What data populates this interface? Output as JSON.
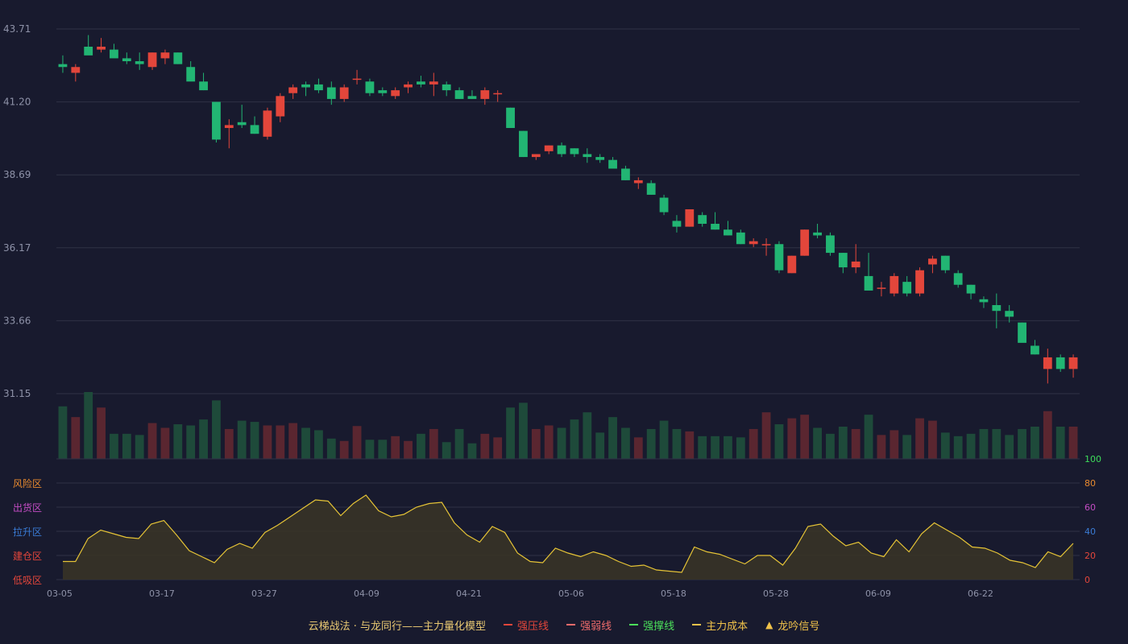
{
  "chart_data": {
    "type": "candlestick",
    "y_ticks": [
      "43.71",
      "41.20",
      "38.69",
      "36.17",
      "33.66",
      "31.15"
    ],
    "ylim": [
      31.15,
      43.71
    ],
    "x_tick_labels": [
      {
        "index": 0,
        "label": "03-05"
      },
      {
        "index": 8,
        "label": "03-17"
      },
      {
        "index": 16,
        "label": "03-27"
      },
      {
        "index": 24,
        "label": "04-09"
      },
      {
        "index": 32,
        "label": "04-21"
      },
      {
        "index": 40,
        "label": "05-06"
      },
      {
        "index": 48,
        "label": "05-18"
      },
      {
        "index": 56,
        "label": "05-28"
      },
      {
        "index": 64,
        "label": "06-09"
      },
      {
        "index": 72,
        "label": "06-22"
      }
    ],
    "ohlc": [
      [
        42.5,
        42.8,
        42.2,
        42.4
      ],
      [
        42.2,
        42.5,
        41.9,
        42.4
      ],
      [
        43.1,
        43.5,
        42.9,
        42.8
      ],
      [
        43.0,
        43.4,
        42.9,
        43.1
      ],
      [
        43.0,
        43.2,
        42.9,
        42.7
      ],
      [
        42.7,
        42.9,
        42.5,
        42.6
      ],
      [
        42.6,
        42.9,
        42.3,
        42.5
      ],
      [
        42.4,
        42.9,
        42.3,
        42.9
      ],
      [
        42.7,
        43.0,
        42.5,
        42.9
      ],
      [
        42.9,
        42.9,
        42.5,
        42.5
      ],
      [
        42.4,
        42.6,
        42.0,
        41.9
      ],
      [
        41.9,
        42.2,
        41.6,
        41.6
      ],
      [
        41.2,
        41.2,
        39.8,
        39.9
      ],
      [
        40.3,
        40.6,
        39.6,
        40.4
      ],
      [
        40.5,
        41.1,
        40.3,
        40.4
      ],
      [
        40.4,
        40.7,
        40.1,
        40.1
      ],
      [
        40.0,
        41.0,
        39.9,
        40.9
      ],
      [
        40.7,
        41.5,
        40.5,
        41.4
      ],
      [
        41.5,
        41.8,
        41.3,
        41.7
      ],
      [
        41.8,
        41.9,
        41.4,
        41.7
      ],
      [
        41.8,
        42.0,
        41.5,
        41.6
      ],
      [
        41.7,
        41.9,
        41.1,
        41.3
      ],
      [
        41.3,
        41.8,
        41.2,
        41.7
      ],
      [
        42.0,
        42.3,
        41.8,
        42.0
      ],
      [
        41.9,
        42.0,
        41.4,
        41.5
      ],
      [
        41.6,
        41.7,
        41.4,
        41.5
      ],
      [
        41.4,
        41.7,
        41.3,
        41.6
      ],
      [
        41.7,
        41.9,
        41.5,
        41.8
      ],
      [
        41.9,
        42.1,
        41.7,
        41.8
      ],
      [
        41.8,
        42.2,
        41.4,
        41.9
      ],
      [
        41.8,
        41.9,
        41.4,
        41.6
      ],
      [
        41.6,
        41.7,
        41.3,
        41.3
      ],
      [
        41.4,
        41.6,
        41.3,
        41.3
      ],
      [
        41.3,
        41.7,
        41.1,
        41.6
      ],
      [
        41.5,
        41.6,
        41.2,
        41.5
      ],
      [
        41.0,
        41.0,
        40.3,
        40.3
      ],
      [
        40.2,
        40.2,
        39.3,
        39.3
      ],
      [
        39.3,
        39.4,
        39.2,
        39.4
      ],
      [
        39.5,
        39.7,
        39.4,
        39.7
      ],
      [
        39.7,
        39.8,
        39.3,
        39.4
      ],
      [
        39.6,
        39.6,
        39.3,
        39.4
      ],
      [
        39.4,
        39.6,
        39.1,
        39.3
      ],
      [
        39.3,
        39.4,
        39.1,
        39.2
      ],
      [
        39.2,
        39.3,
        38.9,
        38.9
      ],
      [
        38.9,
        39.0,
        38.5,
        38.5
      ],
      [
        38.4,
        38.6,
        38.2,
        38.5
      ],
      [
        38.4,
        38.5,
        38.0,
        38.0
      ],
      [
        37.9,
        38.0,
        37.3,
        37.4
      ],
      [
        37.1,
        37.3,
        36.7,
        36.9
      ],
      [
        36.9,
        37.5,
        36.9,
        37.5
      ],
      [
        37.3,
        37.4,
        36.9,
        37.0
      ],
      [
        37.0,
        37.4,
        36.8,
        36.8
      ],
      [
        36.8,
        37.1,
        36.6,
        36.6
      ],
      [
        36.7,
        36.8,
        36.3,
        36.3
      ],
      [
        36.3,
        36.5,
        36.2,
        36.4
      ],
      [
        36.3,
        36.5,
        35.9,
        36.3
      ],
      [
        36.3,
        36.4,
        35.3,
        35.4
      ],
      [
        35.3,
        35.9,
        35.3,
        35.9
      ],
      [
        35.9,
        36.8,
        35.9,
        36.8
      ],
      [
        36.7,
        37.0,
        36.5,
        36.6
      ],
      [
        36.6,
        36.7,
        35.9,
        36.0
      ],
      [
        36.0,
        36.0,
        35.3,
        35.5
      ],
      [
        35.5,
        36.3,
        35.3,
        35.7
      ],
      [
        35.2,
        36.0,
        35.1,
        34.7
      ],
      [
        34.8,
        35.0,
        34.5,
        34.8
      ],
      [
        34.6,
        35.3,
        34.5,
        35.2
      ],
      [
        35.0,
        35.2,
        34.5,
        34.6
      ],
      [
        34.6,
        35.5,
        34.5,
        35.4
      ],
      [
        35.6,
        35.9,
        35.3,
        35.8
      ],
      [
        35.9,
        35.9,
        35.3,
        35.4
      ],
      [
        35.3,
        35.4,
        34.8,
        34.9
      ],
      [
        34.9,
        34.9,
        34.4,
        34.6
      ],
      [
        34.4,
        34.5,
        34.1,
        34.3
      ],
      [
        34.2,
        34.6,
        33.4,
        34.0
      ],
      [
        34.0,
        34.2,
        33.6,
        33.8
      ],
      [
        33.6,
        33.6,
        33.3,
        32.9
      ],
      [
        32.8,
        33.0,
        32.5,
        32.5
      ],
      [
        32.0,
        32.7,
        31.5,
        32.4
      ],
      [
        32.4,
        32.5,
        31.9,
        32.0
      ],
      [
        32.0,
        32.5,
        31.7,
        32.4
      ]
    ],
    "volumes": [
      88,
      70,
      112,
      86,
      42,
      42,
      40,
      60,
      52,
      58,
      56,
      66,
      98,
      50,
      64,
      62,
      56,
      56,
      60,
      52,
      48,
      34,
      30,
      55,
      32,
      32,
      38,
      30,
      42,
      50,
      28,
      50,
      26,
      42,
      36,
      86,
      94,
      50,
      56,
      52,
      66,
      78,
      44,
      70,
      52,
      36,
      50,
      64,
      50,
      46,
      38,
      38,
      38,
      36,
      50,
      78,
      58,
      68,
      74,
      52,
      42,
      54,
      50,
      74,
      40,
      48,
      40,
      68,
      64,
      44,
      38,
      42,
      50,
      50,
      40,
      50,
      54,
      80,
      54,
      54
    ],
    "volume_colors": "same as candle direction",
    "indicator": {
      "name": "主力量化模型",
      "ylim": [
        0,
        100
      ],
      "right_ticks": [
        {
          "v": 100,
          "label": "100",
          "color": "#3ddc5a"
        },
        {
          "v": 80,
          "label": "80",
          "color": "#e88a2e"
        },
        {
          "v": 60,
          "label": "60",
          "color": "#c44cc4"
        },
        {
          "v": 40,
          "label": "40",
          "color": "#3a7bd5"
        },
        {
          "v": 20,
          "label": "20",
          "color": "#e3463b"
        },
        {
          "v": 0,
          "label": "0",
          "color": "#e3463b"
        }
      ],
      "zones": [
        {
          "label": "风险区",
          "color": "#e88a2e"
        },
        {
          "label": "出货区",
          "color": "#c44cc4"
        },
        {
          "label": "拉升区",
          "color": "#3a7bd5"
        },
        {
          "label": "建仓区",
          "color": "#e3463b"
        },
        {
          "label": "低吸区",
          "color": "#e3463b"
        }
      ],
      "values": [
        15,
        15,
        34,
        41,
        38,
        35,
        34,
        46,
        49,
        37,
        24,
        19,
        14,
        25,
        30,
        26,
        39,
        45,
        52,
        59,
        66,
        65,
        53,
        63,
        70,
        57,
        52,
        54,
        60,
        63,
        64,
        47,
        37,
        31,
        44,
        39,
        22,
        15,
        14,
        26,
        22,
        19,
        23,
        20,
        15,
        11,
        12,
        8,
        7,
        6,
        27,
        23,
        21,
        17,
        13,
        20,
        20,
        12,
        26,
        44,
        46,
        36,
        28,
        31,
        22,
        19,
        33,
        23,
        38,
        47,
        41,
        35,
        27,
        26,
        22,
        16,
        14,
        10,
        23,
        19,
        30
      ]
    },
    "colors": {
      "up": "#e3463b",
      "down": "#22b573",
      "up_vol": "#5a2630",
      "down_vol": "#1e4a3a",
      "line": "#e6c436",
      "axis_text": "#8e92a8",
      "grid": "#2f3245"
    }
  },
  "legend": {
    "title": "云梯战法 · 与龙同行——主力量化模型",
    "items": [
      {
        "label": "强压线",
        "color": "#e3463b",
        "style": "solid"
      },
      {
        "label": "强弱线",
        "color": "#ef6b6b",
        "style": "dash"
      },
      {
        "label": "强撑线",
        "color": "#4be05a",
        "style": "solid"
      },
      {
        "label": "主力成本",
        "color": "#f0c24a",
        "style": "dash"
      },
      {
        "label": "龙吟信号",
        "color": "#f0c24a",
        "style": "tri"
      }
    ]
  }
}
